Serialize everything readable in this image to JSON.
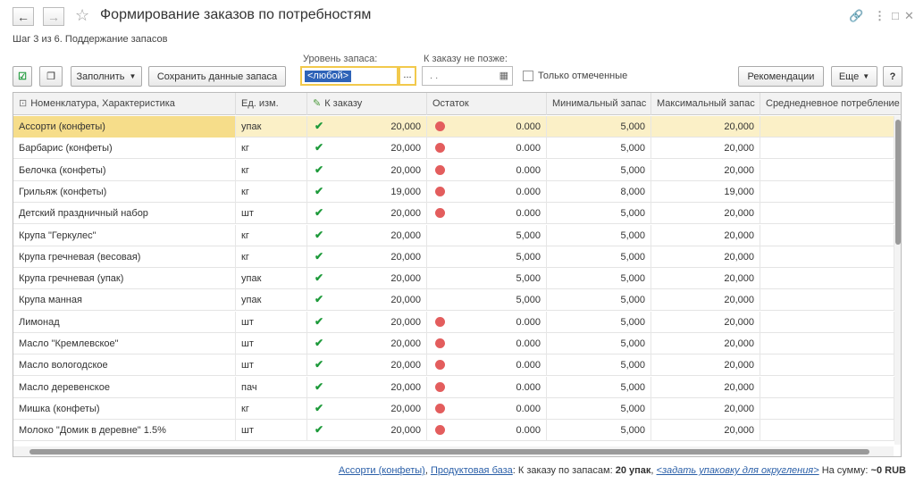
{
  "window": {
    "title": "Формирование заказов по потребностям",
    "step": "Шаг 3 из 6. Поддержание запасов"
  },
  "toolbar": {
    "fill_label": "Заполнить",
    "save_label": "Сохранить данные запаса",
    "recommend_label": "Рекомендации",
    "more_label": "Еще",
    "help_label": "?"
  },
  "filters": {
    "stock_level_label": "Уровень запаса:",
    "stock_level_value": "<любой>",
    "order_by_label": "К заказу не позже:",
    "order_by_value": ". .",
    "only_marked_label": "Только отмеченные"
  },
  "table": {
    "columns": [
      "Номенклатура, Характеристика",
      "Ед. изм.",
      "К заказу",
      "Остаток",
      "Минимальный запас",
      "Максимальный запас",
      "Среднедневное потребление"
    ],
    "rows": [
      {
        "name": "Ассорти (конфеты)",
        "unit": "упак",
        "order": "20,000",
        "low": true,
        "rest": "0.000",
        "min": "5,000",
        "max": "20,000"
      },
      {
        "name": "Барбарис (конфеты)",
        "unit": "кг",
        "order": "20,000",
        "low": true,
        "rest": "0.000",
        "min": "5,000",
        "max": "20,000"
      },
      {
        "name": "Белочка (конфеты)",
        "unit": "кг",
        "order": "20,000",
        "low": true,
        "rest": "0.000",
        "min": "5,000",
        "max": "20,000"
      },
      {
        "name": "Грильяж (конфеты)",
        "unit": "кг",
        "order": "19,000",
        "low": true,
        "rest": "0.000",
        "min": "8,000",
        "max": "19,000"
      },
      {
        "name": "Детский праздничный набор",
        "unit": "шт",
        "order": "20,000",
        "low": true,
        "rest": "0.000",
        "min": "5,000",
        "max": "20,000"
      },
      {
        "name": "Крупа \"Геркулес\"",
        "unit": "кг",
        "order": "20,000",
        "low": false,
        "rest": "5,000",
        "min": "5,000",
        "max": "20,000"
      },
      {
        "name": "Крупа гречневая (весовая)",
        "unit": "кг",
        "order": "20,000",
        "low": false,
        "rest": "5,000",
        "min": "5,000",
        "max": "20,000"
      },
      {
        "name": "Крупа гречневая (упак)",
        "unit": "упак",
        "order": "20,000",
        "low": false,
        "rest": "5,000",
        "min": "5,000",
        "max": "20,000"
      },
      {
        "name": "Крупа манная",
        "unit": "упак",
        "order": "20,000",
        "low": false,
        "rest": "5,000",
        "min": "5,000",
        "max": "20,000"
      },
      {
        "name": "Лимонад",
        "unit": "шт",
        "order": "20,000",
        "low": true,
        "rest": "0.000",
        "min": "5,000",
        "max": "20,000"
      },
      {
        "name": "Масло \"Кремлевское\"",
        "unit": "шт",
        "order": "20,000",
        "low": true,
        "rest": "0.000",
        "min": "5,000",
        "max": "20,000"
      },
      {
        "name": "Масло вологодское",
        "unit": "шт",
        "order": "20,000",
        "low": true,
        "rest": "0.000",
        "min": "5,000",
        "max": "20,000"
      },
      {
        "name": "Масло деревенское",
        "unit": "пач",
        "order": "20,000",
        "low": true,
        "rest": "0.000",
        "min": "5,000",
        "max": "20,000"
      },
      {
        "name": "Мишка (конфеты)",
        "unit": "кг",
        "order": "20,000",
        "low": true,
        "rest": "0.000",
        "min": "5,000",
        "max": "20,000"
      },
      {
        "name": "Молоко \"Домик в деревне\" 1.5%",
        "unit": "шт",
        "order": "20,000",
        "low": true,
        "rest": "0.000",
        "min": "5,000",
        "max": "20,000"
      }
    ]
  },
  "footer": {
    "item_link": "Ассорти (конфеты)",
    "sep": ",",
    "base_link": "Продуктовая база",
    "text1": ": К заказу по запасам:",
    "qty": "20 упак",
    "sep2": ",",
    "pack_link": "<задать упаковку для округления>",
    "text2": "На сумму:",
    "sum": "~0 RUB"
  },
  "colors": {
    "selected_row": "#fbf0c7",
    "accent": "#f2c94c",
    "link": "#2a5fa8",
    "check": "#1d9a3a",
    "dot": "#e35d5d"
  }
}
